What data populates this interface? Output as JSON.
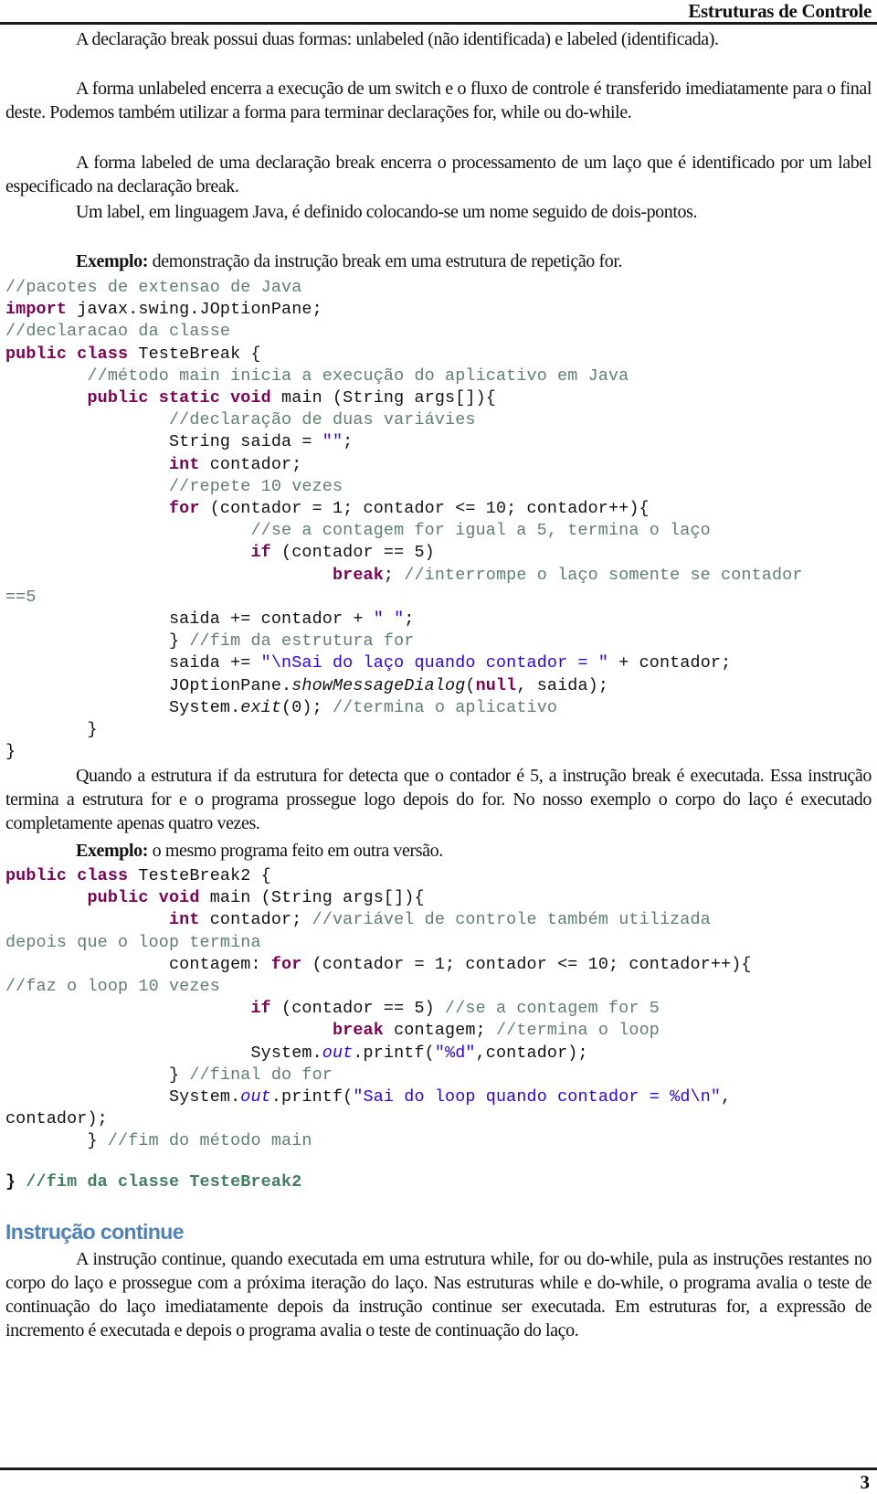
{
  "header": {
    "title": "Estruturas de Controle"
  },
  "paragraphs_top": [
    "A declaração break possui duas formas: unlabeled (não identificada) e labeled (identificada).",
    "A forma unlabeled encerra a execução de um switch e o fluxo de controle é transferido imediatamente para o final deste. Podemos também utilizar a forma para terminar declarações for, while ou do-while.",
    "A forma labeled de uma declaração break encerra o processamento de um laço que é identificado por um label especificado na declaração break.",
    "Um label, em linguagem Java, é definido colocando-se um nome seguido de dois-pontos."
  ],
  "example1": {
    "label": "Exemplo:",
    "text": " demonstração da instrução break em uma estrutura de repetição for."
  },
  "code1": {
    "l1_cm": "//pacotes de extensao de Java",
    "l2_kw": "import",
    "l2_tx": " javax.swing.JOptionPane;",
    "l3_cm": "//declaracao da classe",
    "l4_kw": "public class",
    "l4_tx": " TesteBreak {",
    "l5_cm": "//método main inicia a execução do aplicativo em Java",
    "l6_kw": "public static void",
    "l6_tx": " main (String args[]){",
    "l7_cm": "//declaração de duas variávies",
    "l8_tx": "String saida = ",
    "l8_st": "\"\"",
    "l8_tx2": ";",
    "l9_kw": "int",
    "l9_tx": " contador;",
    "l10_cm": "//repete 10 vezes",
    "l11_kw": "for",
    "l11_tx": " (contador = 1; contador <= 10; contador++){",
    "l12_cm": "//se a contagem for igual a 5, termina o laço",
    "l13_kw": "if",
    "l13_tx": " (contador == 5)",
    "l14_kw": "break",
    "l14_tx": "; ",
    "l14_cm": "//interrompe o laço somente se contador",
    "l15_cm": "==5",
    "l16_tx": "saida += contador + ",
    "l16_st": "\" \"",
    "l16_tx2": ";",
    "l17_tx": "} ",
    "l17_cm": "//fim da estrutura for",
    "l18_tx": "saida += ",
    "l18_st": "\"\\nSai do laço quando contador = \"",
    "l18_tx2": " + contador;",
    "l19_tx": "JOptionPane.",
    "l19_it": "showMessageDialog",
    "l19_tx2": "(",
    "l19_kw": "null",
    "l19_tx3": ", saida);",
    "l20_tx": "System.",
    "l20_it": "exit",
    "l20_tx2": "(0); ",
    "l20_cm": "//termina o aplicativo",
    "l21_tx": "}",
    "l22_tx": "}"
  },
  "paragraph_mid": "Quando a estrutura if da estrutura for detecta que o contador é 5, a instrução break é executada. Essa instrução termina a estrutura for e o programa prossegue logo depois do for. No nosso exemplo o corpo do laço é executado completamente apenas quatro vezes.",
  "example2": {
    "label": "Exemplo:",
    "text": " o mesmo programa feito em outra versão."
  },
  "code2": {
    "l1_kw": "public class",
    "l1_tx": " TesteBreak2 {",
    "l2_kw": "public void",
    "l2_tx": " main (String args[]){",
    "l3_kw": "int",
    "l3_tx": " contador; ",
    "l3_cm": "//variável de controle também utilizada",
    "l4_cm": "depois que o loop termina",
    "l5_tx": "contagem: ",
    "l5_kw": "for",
    "l5_tx2": " (contador = 1; contador <= 10; contador++){",
    "l6_cm": "//faz o loop 10 vezes",
    "l7_kw": "if",
    "l7_tx": " (contador == 5) ",
    "l7_cm": "//se a contagem for 5",
    "l8_kw": "break",
    "l8_tx": " contagem; ",
    "l8_cm": "//termina o loop",
    "l9_tx": "System.",
    "l9_it": "out",
    "l9_tx2": ".printf(",
    "l9_st": "\"%d\"",
    "l9_tx3": ",contador);",
    "l10_tx": "} ",
    "l10_cm": "//final do for",
    "l11_tx": "System.",
    "l11_it": "out",
    "l11_tx2": ".printf(",
    "l11_st": "\"Sai do loop quando contador = %d\\n\"",
    "l11_tx3": ",",
    "l12_tx": "contador);",
    "l13_tx": "} ",
    "l13_cm": "//fim do método main",
    "l14_tx": "} ",
    "l14_cm": "//fim da classe TesteBreak2"
  },
  "section": {
    "heading": "Instrução continue",
    "paragraph": "A instrução continue, quando executada em uma estrutura while, for ou do-while, pula as instruções restantes no corpo do laço e prossegue com a próxima iteração do laço. Nas estruturas while e do-while, o programa avalia o teste de continuação do laço imediatamente depois da instrução continue ser executada. Em estruturas for, a expressão de incremento é executada e depois o programa avalia o teste de continuação do laço."
  },
  "footer": {
    "page_number": "3"
  }
}
